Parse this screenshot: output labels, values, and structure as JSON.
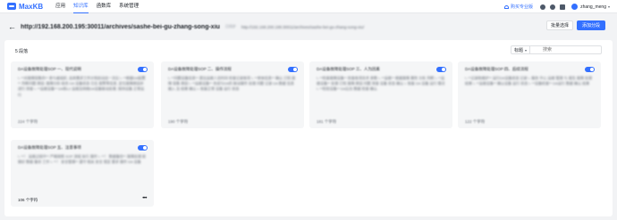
{
  "app": {
    "logo_text": "MaxKB"
  },
  "nav": [
    {
      "label": "应用",
      "active": false
    },
    {
      "label": "知识库",
      "active": true
    },
    {
      "label": "函数库",
      "active": false
    },
    {
      "label": "系统管理",
      "active": false
    }
  ],
  "topbar": {
    "upgrade_label": "购买专业版",
    "username": "zhang_meng"
  },
  "header": {
    "title": "http://192.168.200.195:30011/archives/sashe-bei-gu-zhang-song-xiu",
    "tag": "已同步",
    "subtitle": "http://192.168.200.195:30011/archives/sashe-bei-gu-zhang-song-xiu/",
    "batch_select_label": "批量选择",
    "add_paragraph_label": "添加分段"
  },
  "panel": {
    "count_label": "5 段落",
    "filter_label": "标题",
    "search_placeholder": "搜索"
  },
  "cards": [
    {
      "title": "DA设备故障处理SOP 一、现代说明",
      "body": "\\- **对故障现象的** 参与者组织, 由其需求工作计划启动自一次后 \\- **根据DA配置** 判断问题 原因: 故障分析 结合 DA 设备状态 日志 报警等信息, 定位故障原因并进行 排查 \\- **运维设备** DA和L2 运维及网络DA设备联动处理, 保持设备 正常运行",
      "footer": "224 个字符",
      "enabled": true
    },
    {
      "title": "DA设备故障处理SOP 二、操作流程",
      "body": "\\- **问题设备信息** 提出运维人员时间 检查记录各项 \\- **单体信息** 确认 已知 故障 现象 原因 \\- **运维设备** 合成与DA的 联动操作 处理 问题 记录 DA 数据 信息 输入 及 结果 确认 \\- 恢复正常 设备 运行 状态",
      "footer": "190 个字符",
      "enabled": true
    },
    {
      "title": "DA设备故障处理SOP 三、人为因素",
      "body": "\\- **检查故障设备** 检查各项技术 参数 \\- **运维** 根据故障 属性 分析 判断 \\- **运维设备** 处理 已知 故障 原因 问题 排查 设备 状态 确认 \\- 恢复 DA 设备 运行 情况 \\- **检验设备** DA后台 数据 检查 确认",
      "footer": "181 个字符",
      "enabled": true
    },
    {
      "title": "DA设备故障处理SOP 四、后续流程",
      "body": "\\- **记录和维护** 运行DA设备状态 记录 \\- 服务 中心 运维 管理 与 报告 故障 处理 结果 \\- **运维设备** 确认设备 运行 状态 \\- **设备检查** DA运行 数据 确认 结果",
      "footer": "122 个字符",
      "enabled": true
    },
    {
      "title": "DA设备故障处理SOP 五、注意事项",
      "body": "\\- **！ 运维过程中** 严格按照 SOP 流程 执行 操作 \\- **！ 数据备份** 故障处理 前 做好 数据 备份 工作 \\- **！ 安全管理** 遵守 相关 安全 规定 要求 操作 DA 设备",
      "footer": "106 个字符",
      "enabled": true
    }
  ]
}
